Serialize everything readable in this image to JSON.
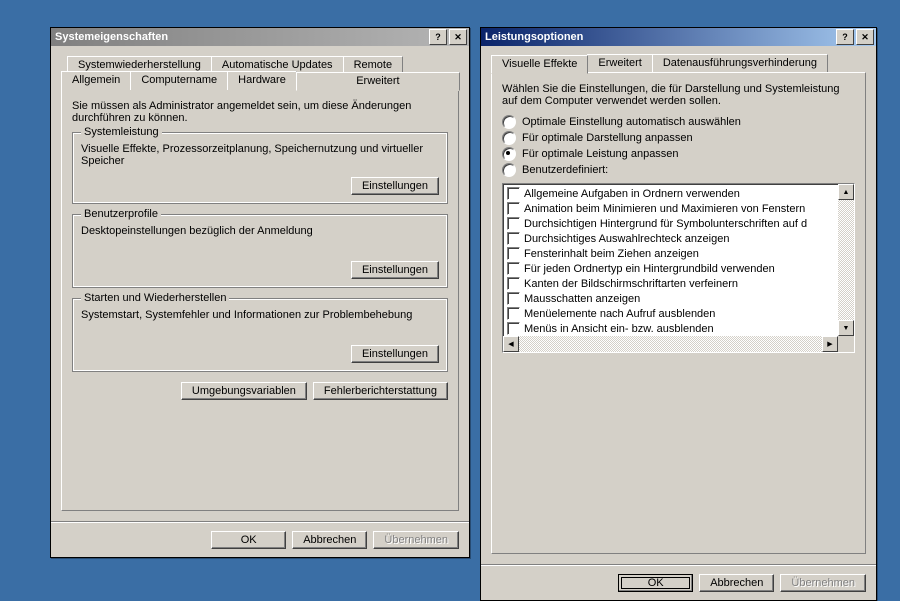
{
  "left": {
    "title": "Systemeigenschaften",
    "tabs_back": [
      "Systemwiederherstellung",
      "Automatische Updates",
      "Remote"
    ],
    "tabs_front": [
      "Allgemein",
      "Computername",
      "Hardware",
      "Erweitert"
    ],
    "active_tab": "Erweitert",
    "intro": "Sie müssen als Administrator angemeldet sein, um diese Änderungen durchführen zu können.",
    "group1": {
      "title": "Systemleistung",
      "text": "Visuelle Effekte, Prozessorzeitplanung, Speichernutzung und virtueller Speicher",
      "btn": "Einstellungen"
    },
    "group2": {
      "title": "Benutzerprofile",
      "text": "Desktopeinstellungen bezüglich der Anmeldung",
      "btn": "Einstellungen"
    },
    "group3": {
      "title": "Starten und Wiederherstellen",
      "text": "Systemstart, Systemfehler und Informationen zur Problembehebung",
      "btn": "Einstellungen"
    },
    "btn_env": "Umgebungsvariablen",
    "btn_err": "Fehlerberichterstattung",
    "ok": "OK",
    "cancel": "Abbrechen",
    "apply": "Übernehmen"
  },
  "right": {
    "title": "Leistungsoptionen",
    "tabs": [
      "Visuelle Effekte",
      "Erweitert",
      "Datenausführungsverhinderung"
    ],
    "active_tab": "Visuelle Effekte",
    "intro": "Wählen Sie die Einstellungen, die für Darstellung und Systemleistung auf dem Computer verwendet werden sollen.",
    "radios": [
      "Optimale Einstellung automatisch auswählen",
      "Für optimale Darstellung anpassen",
      "Für optimale Leistung anpassen",
      "Benutzerdefiniert:"
    ],
    "selected_radio": 2,
    "checks": [
      "Allgemeine Aufgaben in Ordnern verwenden",
      "Animation beim Minimieren und Maximieren von Fenstern",
      "Durchsichtigen Hintergrund für Symbolunterschriften auf d",
      "Durchsichtiges Auswahlrechteck anzeigen",
      "Fensterinhalt beim Ziehen anzeigen",
      "Für jeden Ordnertyp ein Hintergrundbild verwenden",
      "Kanten der Bildschirmschriftarten verfeinern",
      "Mausschatten anzeigen",
      "Menüelemente nach Aufruf ausblenden",
      "Menüs in Ansicht ein- bzw. ausblenden"
    ],
    "ok": "OK",
    "cancel": "Abbrechen",
    "apply": "Übernehmen"
  }
}
